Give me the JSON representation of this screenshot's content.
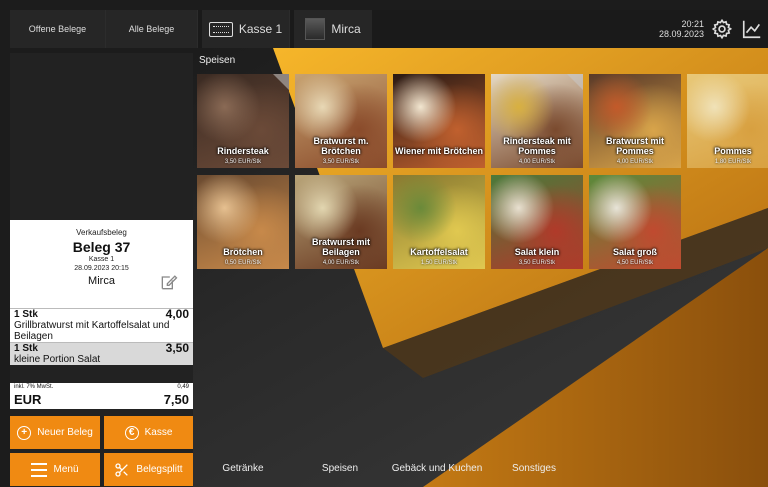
{
  "header": {
    "open_receipts": "Offene Belege",
    "all_receipts": "Alle Belege",
    "register": "Kasse 1",
    "user": "Mirca",
    "time": "20:21",
    "date": "28.09.2023",
    "icons": [
      "keyboard-icon",
      "settings-icon",
      "statistics-icon"
    ]
  },
  "receipt": {
    "type": "Verkaufsbeleg",
    "number": "Beleg 37",
    "register": "Kasse 1",
    "datetime": "28.09.2023 20:15",
    "user": "Mirca",
    "lines": [
      {
        "qty": "1 Stk",
        "price": "4,00",
        "name": "Grillbratwurst mit Kartoffelsalat und Beilagen"
      },
      {
        "qty": "1 Stk",
        "price": "3,50",
        "name": "kleine Portion Salat"
      }
    ],
    "tax_label": "inkl. 7% MwSt.",
    "tax_value": "0,49",
    "currency": "EUR",
    "total": "7,50"
  },
  "actions": {
    "new_receipt": "Neuer Beleg",
    "checkout": "Kasse",
    "menu": "Menü",
    "split": "Belegsplitt"
  },
  "section": "Speisen",
  "products": [
    {
      "name": "Rindersteak",
      "price": "3,50 EUR/Stk",
      "colors": [
        "#3a2a22",
        "#6b4a38",
        "#8a6a55"
      ]
    },
    {
      "name": "Bratwurst m. Brötchen",
      "price": "3,50 EUR/Stk",
      "colors": [
        "#c7a270",
        "#8a4b2b",
        "#e8d8b5"
      ]
    },
    {
      "name": "Wiener mit Brötchen",
      "price": "",
      "colors": [
        "#2a1a14",
        "#c0602e",
        "#f2e6d0"
      ]
    },
    {
      "name": "Rindersteak mit Pommes",
      "price": "4,00 EUR/Stk",
      "colors": [
        "#e5d9c4",
        "#7a4a2e",
        "#d8b040"
      ]
    },
    {
      "name": "Bratwurst mit Pommes",
      "price": "4,00 EUR/Stk",
      "colors": [
        "#5a3a28",
        "#d8a44a",
        "#c35a2a"
      ]
    },
    {
      "name": "Pommes",
      "price": "1,80 EUR/Stk",
      "colors": [
        "#e8c878",
        "#d8a040",
        "#f0e2b8"
      ]
    },
    {
      "name": "Brötchen",
      "price": "0,50 EUR/Stk",
      "colors": [
        "#6a4a30",
        "#c7894a",
        "#e6c090"
      ]
    },
    {
      "name": "Bratwurst mit Beilagen",
      "price": "4,00 EUR/Stk",
      "colors": [
        "#b8a478",
        "#6a3a22",
        "#e2d6b0"
      ]
    },
    {
      "name": "Kartoffelsalat",
      "price": "1,50 EUR/Stk",
      "colors": [
        "#8a7a30",
        "#e0c850",
        "#6a8a3a"
      ]
    },
    {
      "name": "Salat klein",
      "price": "3,50 EUR/Stk",
      "colors": [
        "#4a7a3a",
        "#b03a2a",
        "#e8e0d0"
      ]
    },
    {
      "name": "Salat groß",
      "price": "4,50 EUR/Stk",
      "colors": [
        "#5a8a3a",
        "#c04a30",
        "#e8e4d8"
      ]
    }
  ],
  "categories": [
    "Getränke",
    "Speisen",
    "Gebäck und Kuchen",
    "Sonstiges"
  ],
  "accent": "#f08a12"
}
